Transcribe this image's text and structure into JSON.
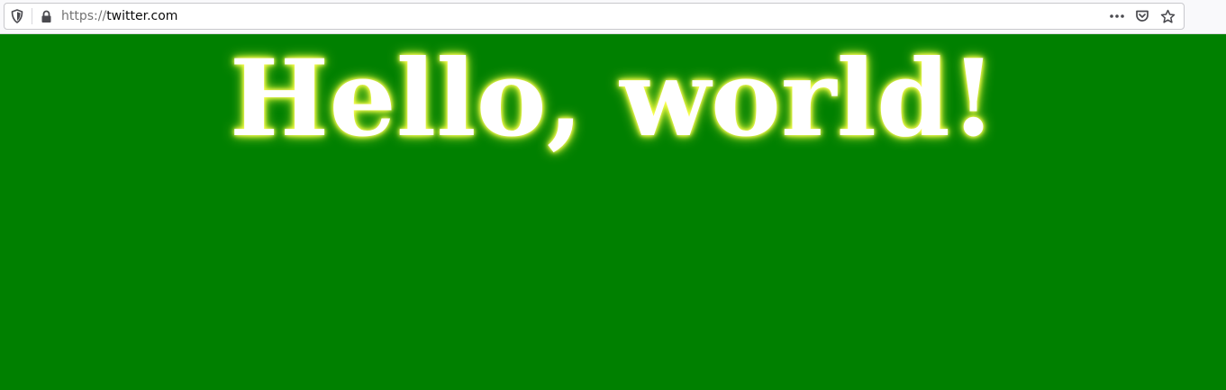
{
  "browser": {
    "url_scheme": "https://",
    "url_host": "twitter.com",
    "icons": {
      "tracking": "shield-icon",
      "security": "lock-icon",
      "page_actions": "more-horizontal-icon",
      "pocket": "pocket-icon",
      "bookmark": "star-icon"
    }
  },
  "page": {
    "headline": "Hello, world!",
    "background_color": "#008000",
    "text_color": "#ffffff",
    "glow_color": "#ffff33"
  }
}
